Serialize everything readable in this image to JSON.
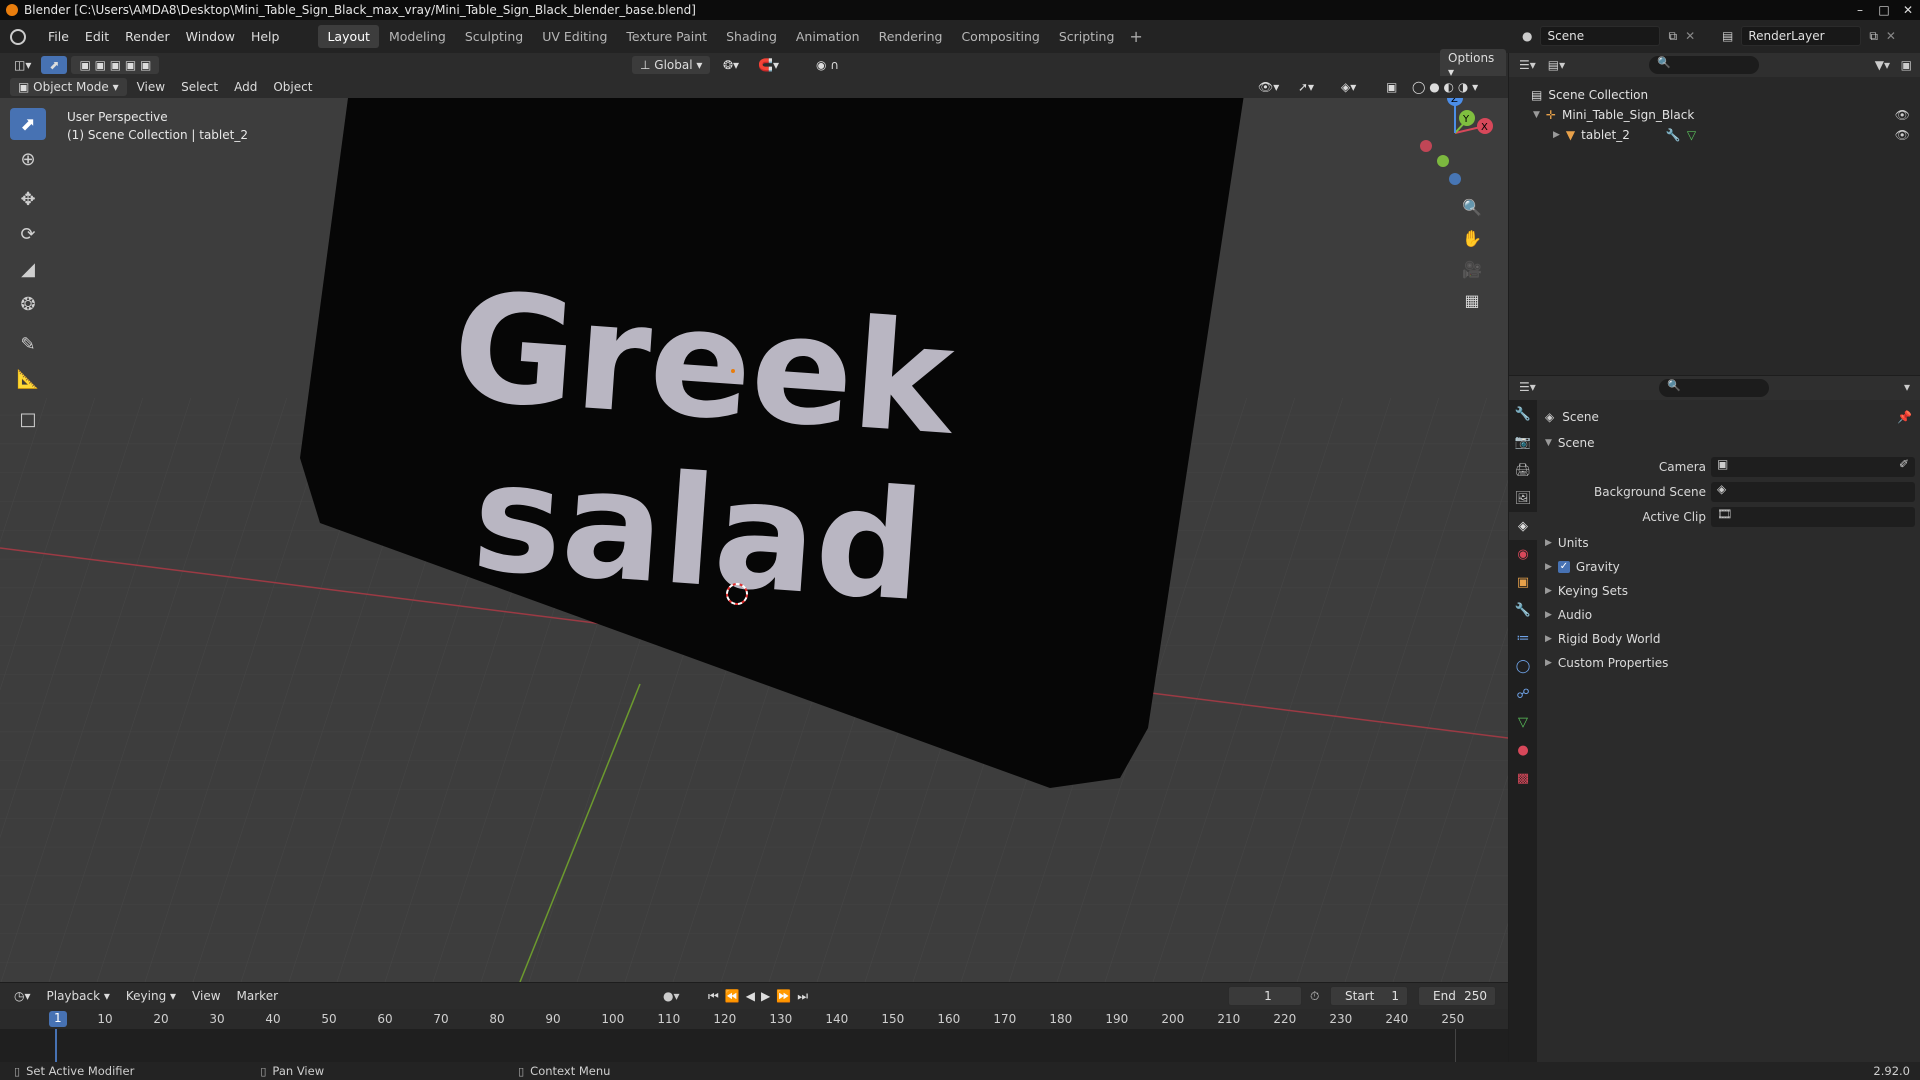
{
  "titlebar": {
    "title": "Blender [C:\\Users\\AMDA8\\Desktop\\Mini_Table_Sign_Black_max_vray/Mini_Table_Sign_Black_blender_base.blend]"
  },
  "menu": [
    "File",
    "Edit",
    "Render",
    "Window",
    "Help"
  ],
  "workspaces": [
    "Layout",
    "Modeling",
    "Sculpting",
    "UV Editing",
    "Texture Paint",
    "Shading",
    "Animation",
    "Rendering",
    "Compositing",
    "Scripting"
  ],
  "active_workspace": "Layout",
  "scene_field": "Scene",
  "layer_field": "RenderLayer",
  "viewport": {
    "transform_orientation": "Global",
    "options_label": "Options",
    "mode": "Object Mode",
    "header_menus": [
      "View",
      "Select",
      "Add",
      "Object"
    ],
    "info_line1": "User Perspective",
    "info_line2": "(1) Scene Collection | tablet_2",
    "sign_text_line1": "Greek",
    "sign_text_line2": "salad",
    "gizmo_x": "X",
    "gizmo_y": "Y",
    "gizmo_z": "Z"
  },
  "outliner": {
    "root": "Scene Collection",
    "items": [
      {
        "label": "Mini_Table_Sign_Black"
      },
      {
        "label": "tablet_2"
      }
    ]
  },
  "properties": {
    "context": "Scene",
    "panel": "Scene",
    "fields": [
      {
        "label": "Camera"
      },
      {
        "label": "Background Scene"
      },
      {
        "label": "Active Clip"
      }
    ],
    "sections": [
      "Units",
      "Gravity",
      "Keying Sets",
      "Audio",
      "Rigid Body World",
      "Custom Properties"
    ]
  },
  "timeline": {
    "menus": [
      "Playback",
      "Keying",
      "View",
      "Marker"
    ],
    "current_frame": "1",
    "start_label": "Start",
    "start": "1",
    "end_label": "End",
    "end": "250",
    "ticks": [
      "10",
      "20",
      "30",
      "40",
      "50",
      "60",
      "70",
      "80",
      "90",
      "100",
      "110",
      "120",
      "130",
      "140",
      "150",
      "160",
      "170",
      "180",
      "190",
      "200",
      "210",
      "220",
      "230",
      "240",
      "250"
    ]
  },
  "statusbar": {
    "left": "Set Active Modifier",
    "mid": "Pan View",
    "right": "Context Menu",
    "version": "2.92.0"
  },
  "colors": {
    "accent": "#4772b3",
    "orange": "#e87d0d",
    "x_axis": "#d7485a",
    "y_axis": "#7fbf3f",
    "z_axis": "#4c8ee8"
  }
}
